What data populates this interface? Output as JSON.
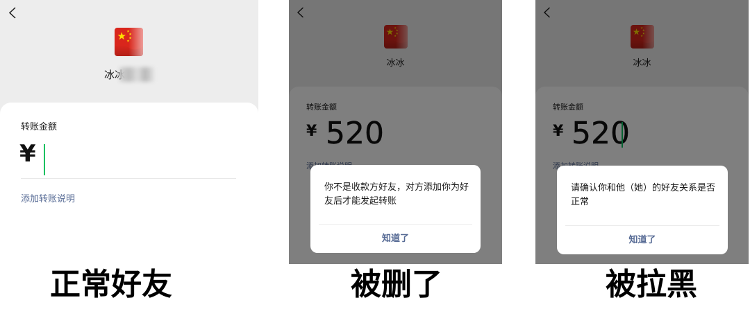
{
  "colors": {
    "top_background": "#ededed",
    "cursor_green": "#07c160",
    "link": "#576b95",
    "mask": "rgba(0,0,0,0.5)"
  },
  "icons": {
    "back": "chevron-left-icon",
    "avatar": "china-flag-avatar"
  },
  "panels": [
    {
      "name": "冰冰",
      "amount_label": "转账金额",
      "currency": "¥",
      "note_link": "添加转账说明",
      "caption": "正常好友"
    },
    {
      "name": "冰冰",
      "amount_label": "转账金额",
      "currency": "¥",
      "amount": "520",
      "note_link": "添加转账说明",
      "dialog": {
        "lines": [
          "你不是收款方好友，对方添加你为好",
          "友后才能发起转账"
        ],
        "button": "知道了"
      },
      "caption": "被删了"
    },
    {
      "name": "冰冰",
      "amount_label": "转账金额",
      "currency": "¥",
      "amount": "520",
      "note_link": "添加转账说明",
      "dialog": {
        "lines": [
          "请确认你和他（她）的好友关系是否",
          "正常"
        ],
        "button": "知道了"
      },
      "caption": "被拉黑"
    }
  ]
}
